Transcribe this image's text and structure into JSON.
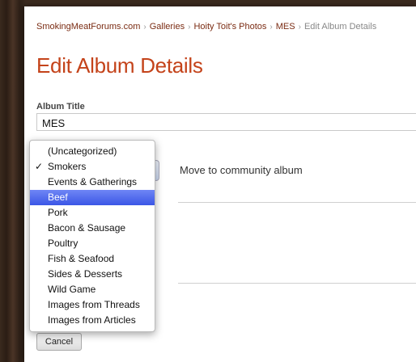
{
  "breadcrumb": {
    "items": [
      "SmokingMeatForums.com",
      "Galleries",
      "Hoity Toit's Photos",
      "MES"
    ],
    "current": "Edit Album Details",
    "separator": "›"
  },
  "page": {
    "title": "Edit Album Details"
  },
  "form": {
    "album_title_label": "Album Title",
    "album_title_value": "MES",
    "move_label": "Move to community album",
    "cancel_label": "Cancel"
  },
  "dropdown": {
    "checked_option": "Smokers",
    "highlighted_option": "Beef",
    "check_glyph": "✓",
    "options": [
      "(Uncategorized)",
      "Smokers",
      "Events & Gatherings",
      "Beef",
      "Pork",
      "Bacon & Sausage",
      "Poultry",
      "Fish & Seafood",
      "Sides & Desserts",
      "Wild Game",
      "Images from Threads",
      "Images from Articles"
    ]
  },
  "colors": {
    "title": "#c4431a",
    "link": "#7a2b12",
    "highlight": "#3b56e6"
  }
}
